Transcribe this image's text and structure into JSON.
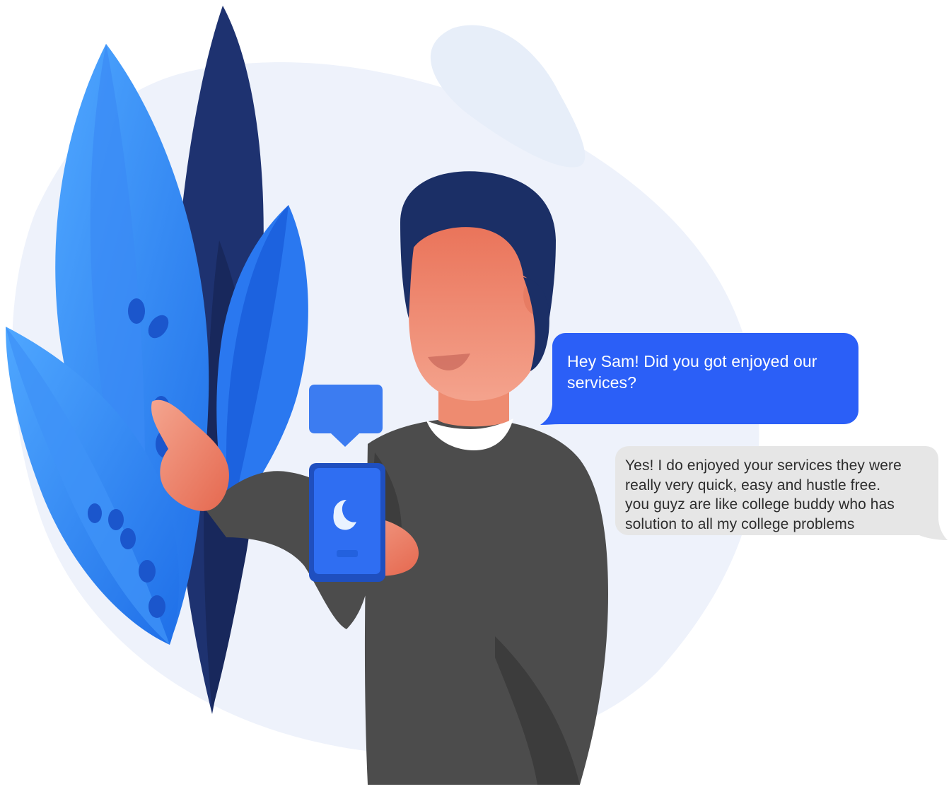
{
  "conversation": {
    "incoming_message": "Hey Sam! Did you got enjoyed our\n services?",
    "reply_message": "Yes! I do enjoyed your services they were\nreally very quick, easy and hustle free.\nyou guyz are like college buddy who has\nsolution to all my college problems"
  },
  "illustration": {
    "icons": [
      "person-illustration",
      "smartphone-icon",
      "chat-icon",
      "leaf-icon"
    ]
  },
  "colors": {
    "blue_bubble": "#2b5ff7",
    "gray_bubble": "#e6e6e6",
    "sweater": "#4a4a4a",
    "hair": "#1b2f66",
    "skin": "#ee8b70",
    "background_blob": "#eef2fb"
  }
}
